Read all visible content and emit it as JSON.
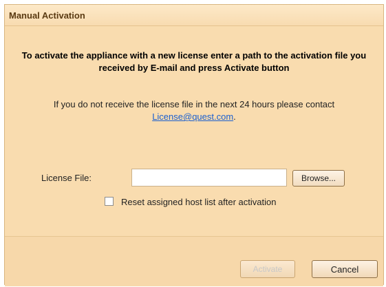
{
  "dialog": {
    "title": "Manual Activation",
    "instruction": "To activate the appliance with a new license enter a path to the activation file you received by E-mail and press Activate button",
    "note_prefix": "If you do not receive the license file in the next 24 hours please contact ",
    "note_link": "License@quest.com",
    "note_suffix": ".",
    "license_label": "License File:",
    "license_value": "",
    "browse_label": "Browse...",
    "checkbox_label": "Reset assigned host list after activation",
    "checkbox_checked": false,
    "activate_label": "Activate",
    "cancel_label": "Cancel"
  },
  "colors": {
    "dialog_background": "#f9dcaf",
    "link": "#1a5fd0",
    "disabled_text": "#c7c7c7"
  }
}
